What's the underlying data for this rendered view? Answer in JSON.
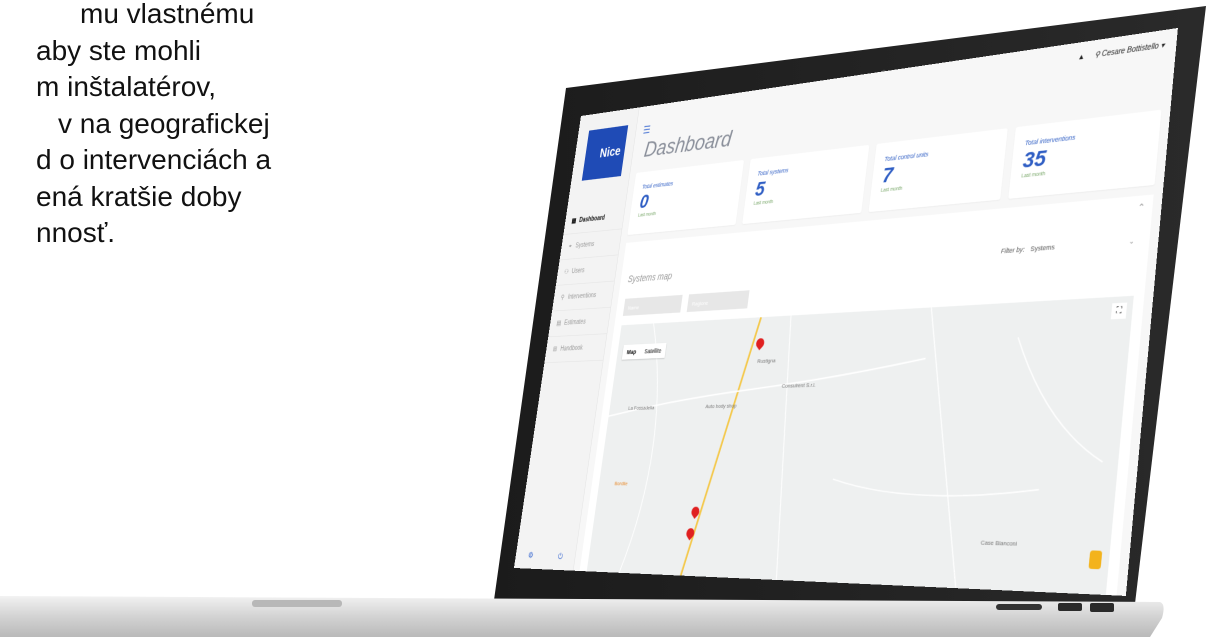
{
  "copy": {
    "lines": [
      "mu vlastnému",
      "aby ste mohli",
      "m inštalatérov,",
      "v na geografickej",
      "d o intervenciách a",
      "ená kratšie doby",
      "nnosť."
    ]
  },
  "app": {
    "logo": "Nice",
    "user": "Cesare Bottistello",
    "page_title": "Dashboard",
    "nav": [
      {
        "label": "Dashboard",
        "icon": "grid-icon"
      },
      {
        "label": "Systems",
        "icon": "pin-icon"
      },
      {
        "label": "Users",
        "icon": "users-icon"
      },
      {
        "label": "Interventions",
        "icon": "wrench-icon"
      },
      {
        "label": "Estimates",
        "icon": "doc-icon"
      },
      {
        "label": "Handbook",
        "icon": "book-icon"
      }
    ],
    "cards": [
      {
        "label": "Total estimates",
        "value": "0",
        "sub": "Last month"
      },
      {
        "label": "Total systems",
        "value": "5",
        "sub": "Last month"
      },
      {
        "label": "Total control units",
        "value": "7",
        "sub": "Last month"
      },
      {
        "label": "Total interventions",
        "value": "35",
        "sub": "Last month"
      }
    ],
    "map_panel": {
      "title": "Systems map",
      "filter_label": "Filter by:",
      "filter_value": "Systems",
      "input1": "Name",
      "input2": "Ragione",
      "map_tab": "Map",
      "satellite_tab": "Satellite",
      "places": [
        "Rustigna",
        "La Fossadella",
        "Case Bianconi",
        "Bordile",
        "Consulrent S.r.l.",
        "Auto body shop"
      ]
    }
  },
  "colors": {
    "accent": "#2f5ec4",
    "logo": "#1f4bb6",
    "pin": "#e02020"
  }
}
